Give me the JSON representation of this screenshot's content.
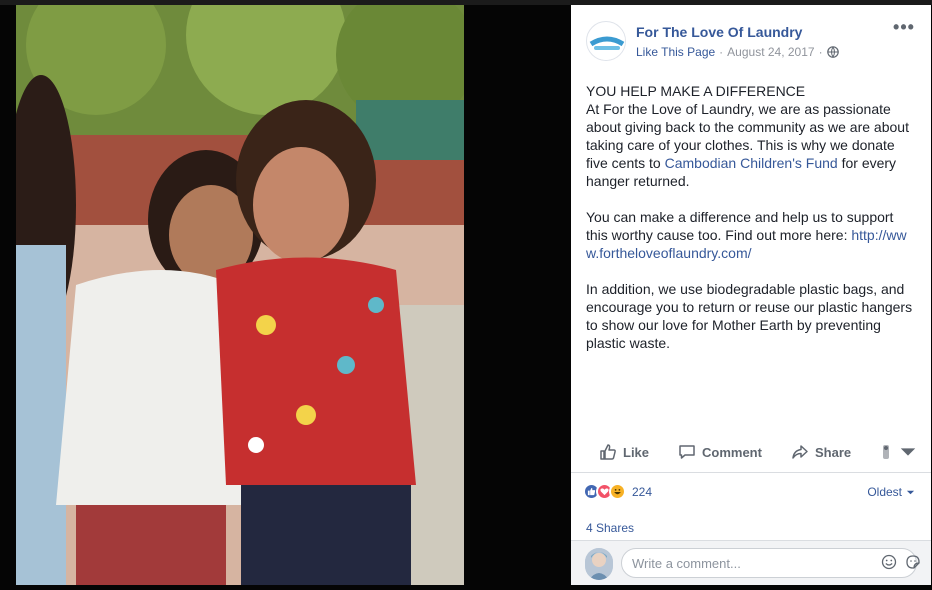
{
  "post": {
    "page_name": "For The Love Of Laundry",
    "like_page": "Like This Page",
    "date": "August 24, 2017",
    "separator": "·",
    "avatar_text_top": "FOR THE",
    "avatar_text_mid": "LOVE OF LAUNDRY",
    "avatar_text_bot": "*Powered Eco Shiners*",
    "paragraphs": {
      "p1_heading": "YOU HELP MAKE A DIFFERENCE",
      "p1_a": "At For the Love of Laundry, we are as passionate about giving back to the community as we are about taking care of your clothes. This is why we donate five cents to ",
      "p1_link": "Cambodian Children's Fund",
      "p1_b": " for every hanger returned.",
      "p2_a": "You can make a difference and help us to support this worthy cause too. Find out more here: ",
      "p2_link": "http://www.fortheloveoflaundry.com/",
      "p3": "In addition, we use biodegradable plastic bags, and encourage you to return or reuse our plastic hangers to show our love for Mother Earth by preventing plastic waste."
    }
  },
  "actions": {
    "like": "Like",
    "comment": "Comment",
    "share": "Share"
  },
  "reactions": {
    "count": "224",
    "sort": "Oldest",
    "shares": "4 Shares"
  },
  "comment_box": {
    "placeholder": "Write a comment..."
  },
  "colors": {
    "link": "#365899",
    "like_blue": "#4267b2",
    "love_red": "#f25268",
    "haha_yellow": "#f7b125"
  },
  "icons": [
    "more-icon",
    "globe-icon",
    "like-icon",
    "comment-icon",
    "share-icon",
    "reactor-icon",
    "chevron-down-icon",
    "emoji-icon",
    "sticker-icon"
  ]
}
